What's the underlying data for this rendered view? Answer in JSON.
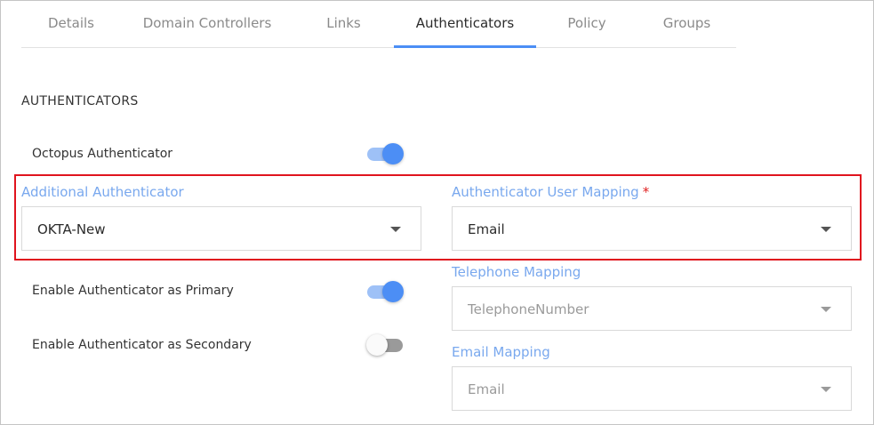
{
  "tabs": [
    {
      "label": "Details"
    },
    {
      "label": "Domain Controllers"
    },
    {
      "label": "Links"
    },
    {
      "label": "Authenticators"
    },
    {
      "label": "Policy"
    },
    {
      "label": "Groups"
    }
  ],
  "active_tab": "Authenticators",
  "section": {
    "title": "AUTHENTICATORS"
  },
  "toggles": {
    "octopus": {
      "label": "Octopus Authenticator",
      "state": "on"
    },
    "primary": {
      "label": "Enable Authenticator as Primary",
      "state": "on"
    },
    "secondary": {
      "label": "Enable Authenticator as Secondary",
      "state": "off"
    }
  },
  "fields": {
    "additional_authenticator": {
      "label": "Additional Authenticator",
      "value": "OKTA-New"
    },
    "user_mapping": {
      "label": "Authenticator User Mapping",
      "required_marker": "*",
      "value": "Email"
    },
    "telephone_mapping": {
      "label": "Telephone Mapping",
      "value": "TelephoneNumber"
    },
    "email_mapping": {
      "label": "Email Mapping",
      "value": "Email"
    }
  },
  "colors": {
    "accent": "#4c8ef5",
    "field_label": "#79a8ee",
    "highlight_border": "#e0141e",
    "required": "#e02020"
  }
}
